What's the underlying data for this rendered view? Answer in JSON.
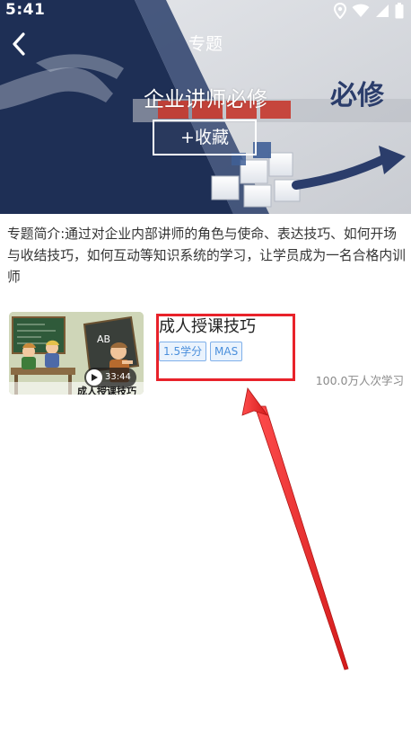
{
  "status_bar": {
    "time": "5:41",
    "icons": [
      "location-icon",
      "wifi-icon",
      "signal-icon",
      "battery-icon"
    ]
  },
  "header": {
    "back_icon": "back-arrow-icon",
    "title": "专题"
  },
  "banner": {
    "topic_name": "企业讲师必修",
    "collect_label": "+收藏",
    "art_text": "必修"
  },
  "intro": {
    "text": "专题简介:通过对企业内部讲师的角色与使命、表达技巧、如何开场与收结技巧，如何互动等知识系统的学习，让学员成为一名合格内训师"
  },
  "courses": [
    {
      "title": "成人授课技巧",
      "thumbnail_caption": "成人授课技巧",
      "duration": "33:44",
      "tags": [
        "1.5学分",
        "MAS"
      ],
      "learners": "100.0万人次学习"
    }
  ],
  "colors": {
    "tag_text": "#4a8fdc",
    "tag_border": "#7fb0ea",
    "annotation_red": "#e8222a",
    "banner_navy": "#1e2f55"
  }
}
